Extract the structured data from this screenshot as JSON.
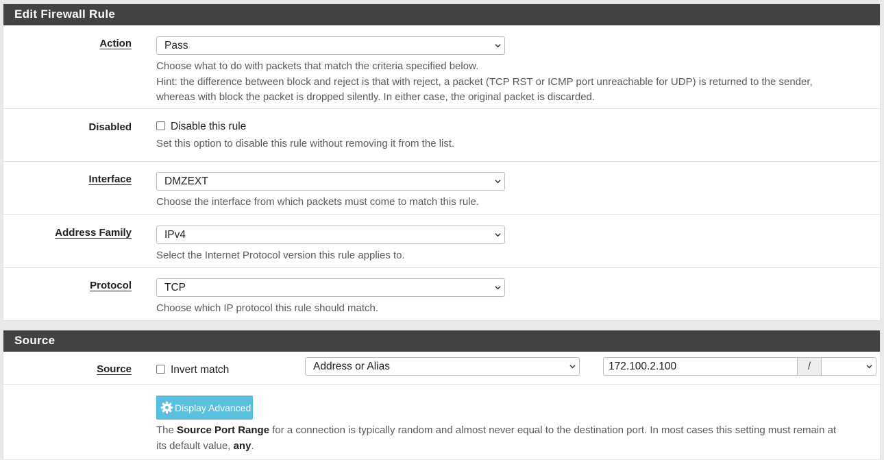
{
  "edit_panel": {
    "title": "Edit Firewall Rule",
    "action": {
      "label": "Action",
      "selected": "Pass",
      "help_1": "Choose what to do with packets that match the criteria specified below.",
      "help_2": "Hint: the difference between block and reject is that with reject, a packet (TCP RST or ICMP port unreachable for UDP) is returned to the sender,",
      "help_3": "whereas with block the packet is dropped silently. In either case, the original packet is discarded."
    },
    "disabled": {
      "label": "Disabled",
      "checkbox_label": "Disable this rule",
      "checked": false,
      "help": "Set this option to disable this rule without removing it from the list."
    },
    "interface": {
      "label": "Interface",
      "selected": "DMZEXT",
      "help": "Choose the interface from which packets must come to match this rule."
    },
    "address_family": {
      "label": "Address Family",
      "selected": "IPv4",
      "help": "Select the Internet Protocol version this rule applies to."
    },
    "protocol": {
      "label": "Protocol",
      "selected": "TCP",
      "help": "Choose which IP protocol this rule should match."
    }
  },
  "source_panel": {
    "title": "Source",
    "source": {
      "label": "Source",
      "invert_label": "Invert match",
      "invert_checked": false,
      "type_selected": "Address or Alias",
      "address_value": "172.100.2.100",
      "slash": "/",
      "mask_selected": ""
    },
    "advanced": {
      "button_label": "Display Advanced",
      "help_pre": "The ",
      "help_bold": "Source Port Range",
      "help_mid": " for a connection is typically random and almost never equal to the destination port. In most cases this setting must remain at",
      "help_line2_pre": "its default value, ",
      "help_line2_bold": "any",
      "help_line2_post": "."
    }
  },
  "colors": {
    "panel_heading_bg": "#424242",
    "info_button_bg": "#5bc0de",
    "help_text": "#5a5a5a"
  },
  "icons": {
    "select_arrow": "chevron-down-icon",
    "advanced_button": "gear-icon"
  }
}
